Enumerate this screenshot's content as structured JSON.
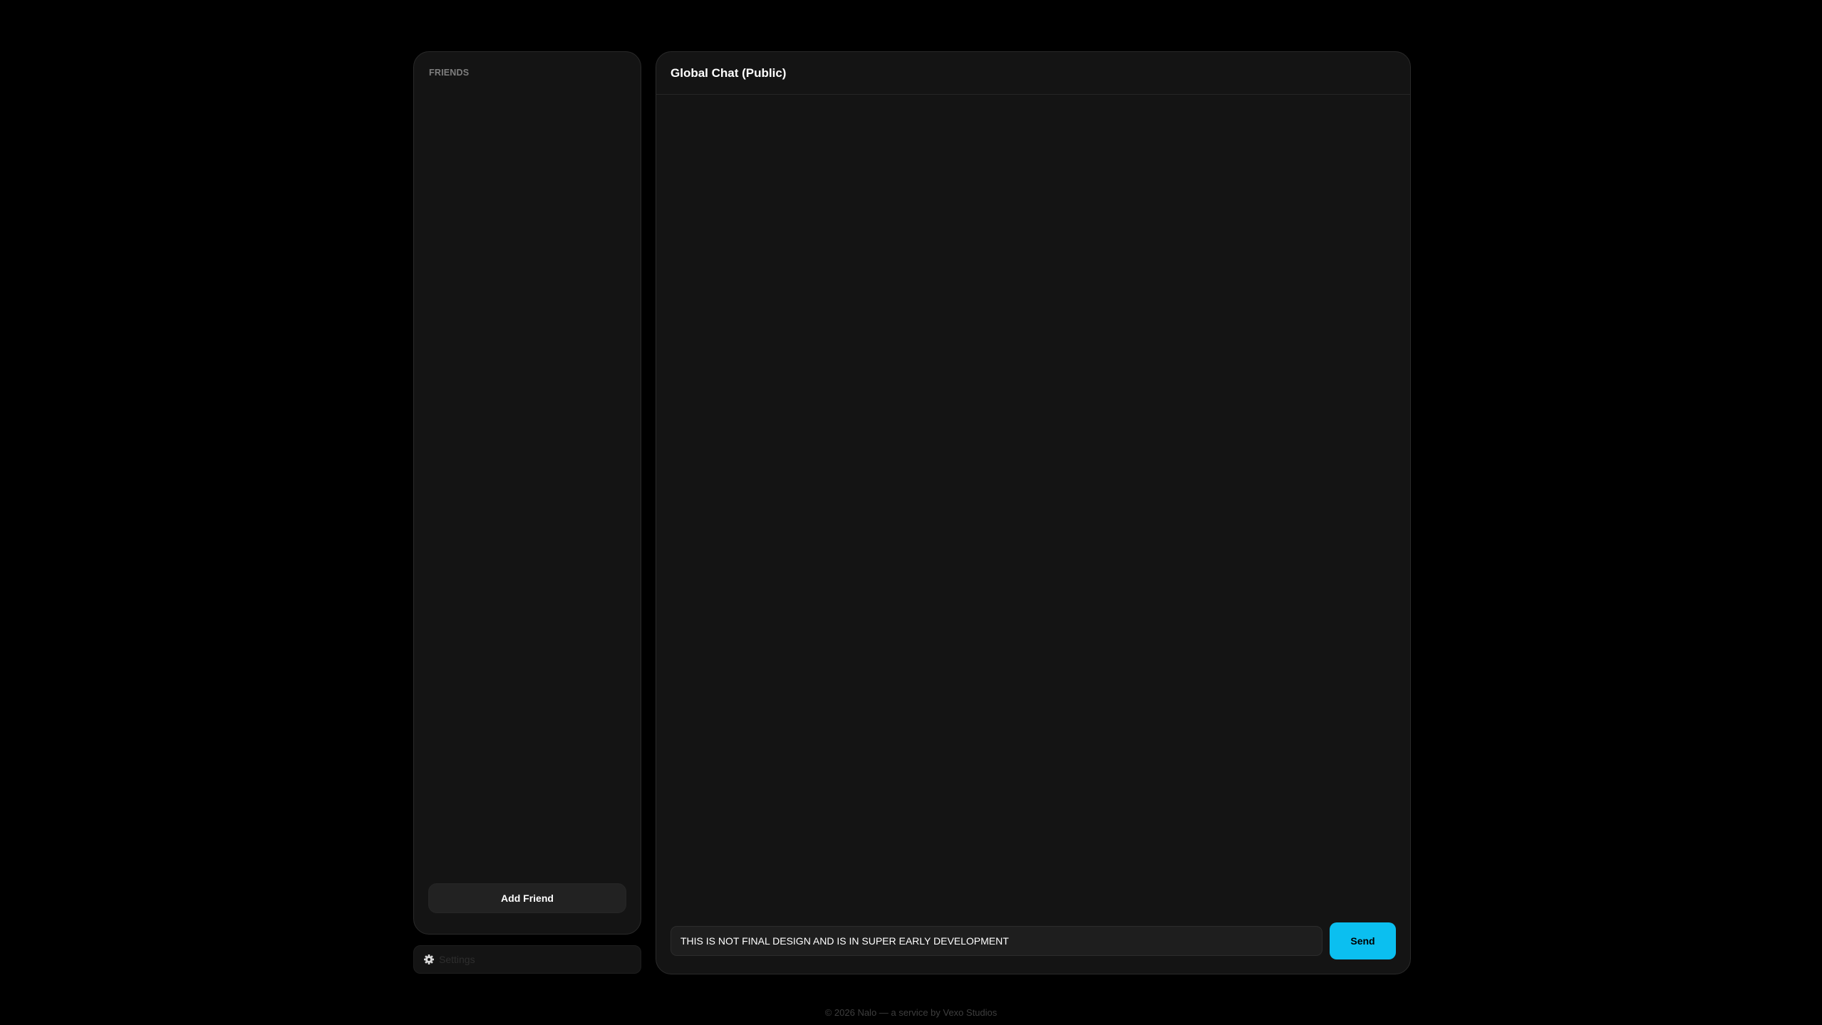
{
  "sidebar": {
    "title": "FRIENDS",
    "add_friend_label": "Add Friend"
  },
  "settings": {
    "icon": "gear-icon",
    "label": "Settings"
  },
  "chat": {
    "title": "Global Chat (Public)",
    "input_value": "THIS IS NOT FINAL DESIGN AND IS IN SUPER EARLY DEVELOPMENT",
    "send_label": "Send"
  },
  "footer": {
    "text": "© 2026 Nalo — a service by Vexo Studios"
  },
  "colors": {
    "background": "#000000",
    "panel": "#141414",
    "accent": "#0bbff0"
  }
}
